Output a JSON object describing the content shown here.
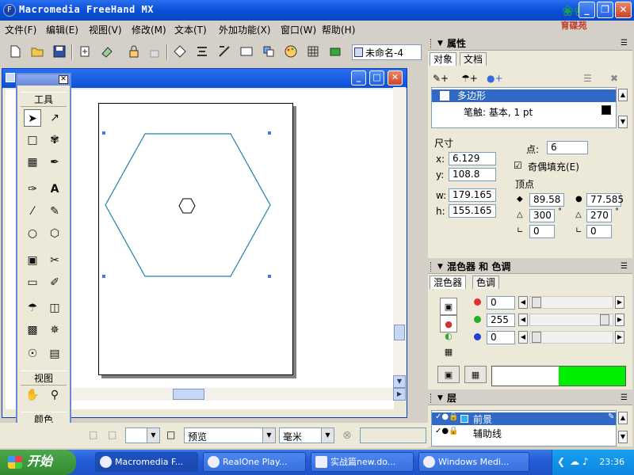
{
  "app": {
    "title": "Macromedia FreeHand MX",
    "logo_text": "育碟苑"
  },
  "menu": [
    "文件(F)",
    "编辑(E)",
    "视图(V)",
    "修改(M)",
    "文本(T)",
    "外加功能(X)",
    "窗口(W)",
    "帮助(H)"
  ],
  "toolbar": {
    "document_name": "未命名-4"
  },
  "tools_panel": {
    "section_tools": "工具",
    "section_view": "视图",
    "section_color": "颜色"
  },
  "properties": {
    "title": "属性",
    "tabs": [
      "对象",
      "文档"
    ],
    "list": {
      "selected": "多边形",
      "stroke": "笔触: 基本, 1 pt"
    },
    "dimensions_label": "尺寸",
    "x_label": "x:",
    "x": "6.129",
    "y_label": "y:",
    "y": "108.8",
    "w_label": "w:",
    "w": "179.165",
    "h_label": "h:",
    "h": "155.165",
    "points_label": "点:",
    "points": "6",
    "even_odd": "奇偶填充(E)",
    "vertex_label": "顶点",
    "v1a": "89.58",
    "v1b": "300",
    "v1c": "0",
    "v2a": "77.585",
    "v2b": "270",
    "v2c": "0",
    "degree": "°"
  },
  "mixer": {
    "title": "混色器 和 色调",
    "tabs": [
      "混色器",
      "色调"
    ],
    "r": "0",
    "g": "255",
    "b": "0",
    "preview_color": "#00ee00"
  },
  "layers": {
    "title": "层",
    "items": [
      {
        "name": "前景",
        "selected": true
      },
      {
        "name": "辅助线",
        "selected": false
      }
    ]
  },
  "statusbar": {
    "view_mode": "预览",
    "units": "毫米"
  },
  "taskbar": {
    "start": "开始",
    "items": [
      "Macromedia F...",
      "RealOne Play...",
      "实战篇new.do...",
      "Windows Medi..."
    ],
    "clock": "23:36"
  },
  "colors": {
    "accent": "#3169c6",
    "hexagon_stroke": "#1f7fa8"
  }
}
